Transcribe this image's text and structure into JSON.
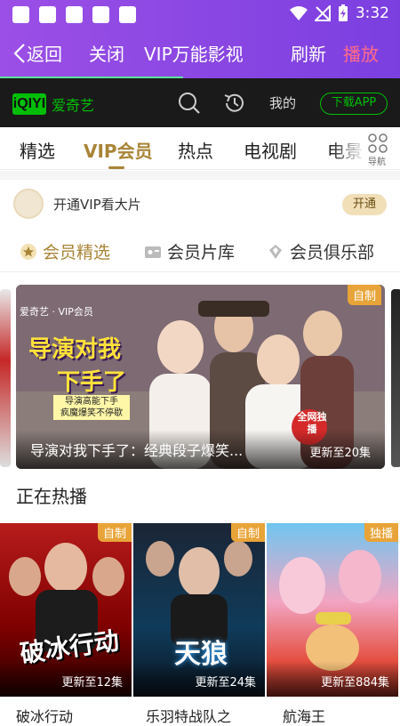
{
  "status": {
    "time": "3:32",
    "accent": "#8a47e3"
  },
  "toolbar": {
    "back_label": "返回",
    "close_label": "关闭",
    "title": "VIP万能影视",
    "refresh_label": "刷新",
    "play_label": "播放",
    "play_color": "#ff6b8a"
  },
  "iqiyi": {
    "logo_text": "iQIYI",
    "brand_name": "爱奇艺",
    "mine_label": "我的",
    "download_label": "下载APP",
    "brand_color": "#00be06"
  },
  "nav": {
    "tabs": [
      {
        "label": "精选"
      },
      {
        "label": "VIP会员"
      },
      {
        "label": "热点"
      },
      {
        "label": "电视剧"
      },
      {
        "label": "电景"
      }
    ],
    "active_index": 1,
    "grid_label": "导航"
  },
  "vip_row": {
    "text": "开通VIP看大片",
    "open_label": "开通"
  },
  "subtabs": [
    {
      "label": "会员精选",
      "icon": "star-badge-icon"
    },
    {
      "label": "会员片库",
      "icon": "film-library-icon"
    },
    {
      "label": "会员俱乐部",
      "icon": "diamond-club-icon"
    }
  ],
  "banner": {
    "tag": "自制",
    "brand": "爱奇艺 · VIP会员",
    "title": "导演对我下手了：经典段子爆笑...",
    "update": "更新至20集",
    "art_line1": "导演对我",
    "art_line2": "下手了",
    "art_sub1": "导演高能下手",
    "art_sub2": "疯魔爆笑不停歇",
    "badge_text": "全网独播"
  },
  "hot": {
    "title": "正在热播",
    "cards": [
      {
        "name": "破冰行动",
        "tag": "自制",
        "update": "更新至12集",
        "art": "破冰行动"
      },
      {
        "name": "乐羽特战队之",
        "tag": "自制",
        "update": "更新至24集",
        "art": "天狼"
      },
      {
        "name": "航海王",
        "tag": "独播",
        "update": "更新至884集",
        "art": ""
      }
    ]
  }
}
